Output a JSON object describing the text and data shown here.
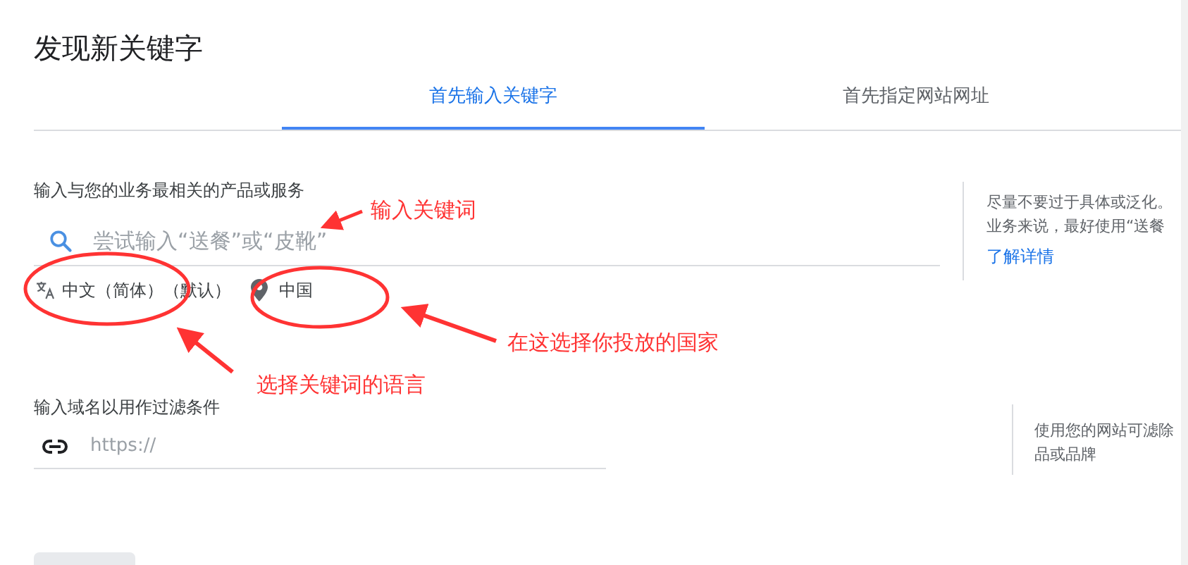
{
  "title": "发现新关键字",
  "tabs": [
    {
      "label": "首先输入关键字",
      "selected": true
    },
    {
      "label": "首先指定网站网址",
      "selected": false
    }
  ],
  "keyword_section": {
    "label": "输入与您的业务最相关的产品或服务",
    "search": {
      "placeholder": "尝试输入“送餐”或“皮靴”"
    },
    "language": "中文（简体）（默认）",
    "location": "中国",
    "hint_lines": [
      "尽量不要过于具体或泛化。",
      "业务来说，最好使用“送餐"
    ],
    "learn_more": "了解详情"
  },
  "domain_section": {
    "label": "输入域名以用作过滤条件",
    "url": {
      "placeholder": "https://"
    },
    "hint_lines": [
      "使用您的网站可滤除",
      "品或品牌"
    ]
  },
  "annotations": [
    {
      "text": "输入关键词"
    },
    {
      "text": "在这选择你投放的国家"
    },
    {
      "text": "选择关键词的语言"
    }
  ]
}
